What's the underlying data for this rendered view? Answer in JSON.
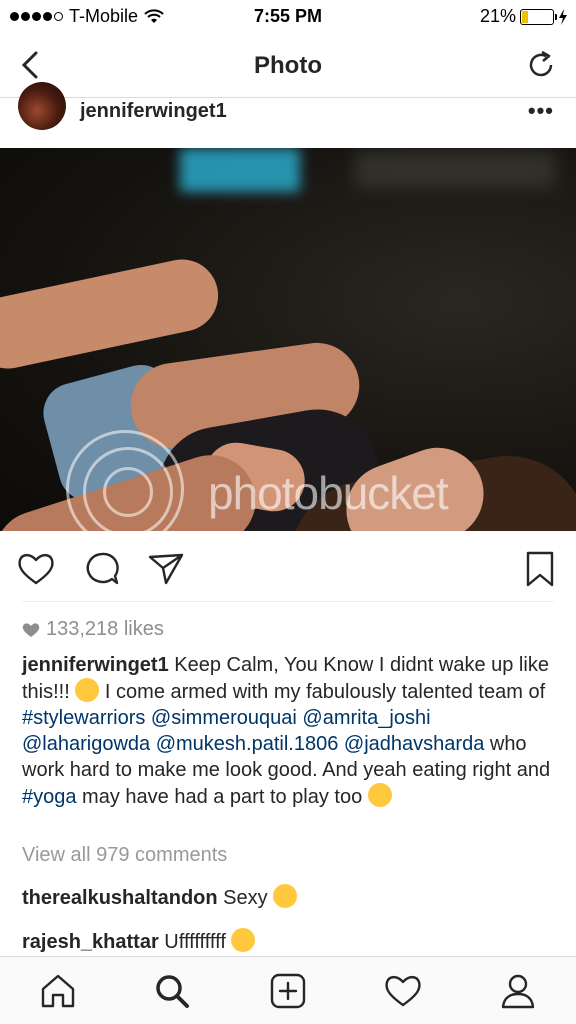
{
  "status_bar": {
    "carrier": "T-Mobile",
    "time": "7:55 PM",
    "battery": "21%"
  },
  "header": {
    "title": "Photo"
  },
  "post": {
    "username": "jenniferwinget1",
    "more_label": "•••",
    "watermark": "photobucket",
    "likes": "133,218 likes",
    "caption": {
      "username": "jenniferwinget1",
      "text1": " Keep Calm, You Know I didnt wake up like this!!! ",
      "text2": " I come armed with my fabulously talented team of ",
      "tag_stylewarriors": "#stylewarriors",
      "mention_simmerouquai": "@simmerouquai",
      "mention_amrita": "@amrita_joshi",
      "mention_laharigowda": "@laharigowda",
      "mention_mukesh": "@mukesh.patil.1806",
      "mention_jadhav": "@jadhavsharda",
      "text3": " who work hard to make me look good. And yeah eating right and ",
      "tag_yoga": "#yoga",
      "text4": " may have had a part to play too "
    },
    "view_all": "View all 979 comments",
    "comments": [
      {
        "username": "therealkushaltandon",
        "text": " Sexy "
      },
      {
        "username": "rajesh_khattar",
        "text": " Ufffffffff "
      }
    ]
  },
  "icons": {
    "accent": "#003569",
    "muted": "#8e8e8e",
    "battery_fill": "#f0c000"
  }
}
